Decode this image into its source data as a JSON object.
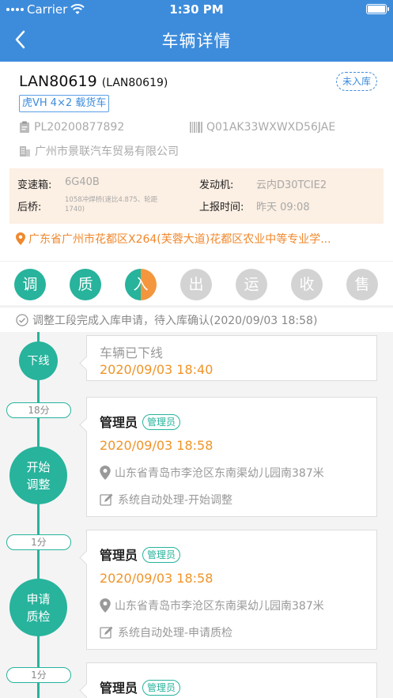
{
  "status_bar": {
    "carrier": "Carrier",
    "time": "1:30 PM"
  },
  "nav": {
    "title": "车辆详情"
  },
  "vehicle": {
    "plate": "LAN80619",
    "plate_sub": "(LAN80619)",
    "status": "未入库",
    "model": "虎VH 4×2 载货车",
    "pl_code": "PL20200877892",
    "vin": "Q01AK33WXWXD56JAE",
    "company": "广州市景联汽车贸易有限公司",
    "specs": {
      "gearbox_label": "变速箱:",
      "gearbox_value": "6G40B",
      "engine_label": "发动机:",
      "engine_value": "云内D30TCIE2",
      "axle_label": "后桥:",
      "axle_value": "1058冲焊桥(速比4.875、轮距1740)",
      "report_label": "上报时间:",
      "report_value": "昨天 09:08"
    },
    "address": "广东省广州市花都区X264(芙蓉大道)花都区农业中等专业学..."
  },
  "stages": [
    {
      "label": "调",
      "state": "done"
    },
    {
      "label": "质",
      "state": "done"
    },
    {
      "label": "入",
      "state": "current"
    },
    {
      "label": "出",
      "state": "todo"
    },
    {
      "label": "运",
      "state": "todo"
    },
    {
      "label": "收",
      "state": "todo"
    },
    {
      "label": "售",
      "state": "todo"
    }
  ],
  "notice": "调整工段完成入库申请，待入库确认(2020/09/03 18:58)",
  "timeline": {
    "nodes": [
      {
        "label": "下线"
      },
      {
        "label": "开始\n调整"
      },
      {
        "label": "申请\n质检"
      }
    ],
    "durations": [
      "18分",
      "1分",
      "1分"
    ],
    "events": [
      {
        "title": "车辆已下线",
        "time": "2020/09/03 18:40"
      },
      {
        "operator": "管理员",
        "role": "管理员",
        "time": "2020/09/03 18:58",
        "location": "山东省青岛市李沧区东南渠幼儿园南387米",
        "desc": "系统自动处理-开始调整"
      },
      {
        "operator": "管理员",
        "role": "管理员",
        "time": "2020/09/03 18:58",
        "location": "山东省青岛市李沧区东南渠幼儿园南387米",
        "desc": "系统自动处理-申请质检"
      },
      {
        "operator": "管理员",
        "role": "管理员"
      }
    ]
  },
  "colors": {
    "primary": "#3d8cdc",
    "green": "#27b39c",
    "orange": "#f3963d",
    "time_orange": "#f09428",
    "spec_bg": "#fcefe3"
  }
}
